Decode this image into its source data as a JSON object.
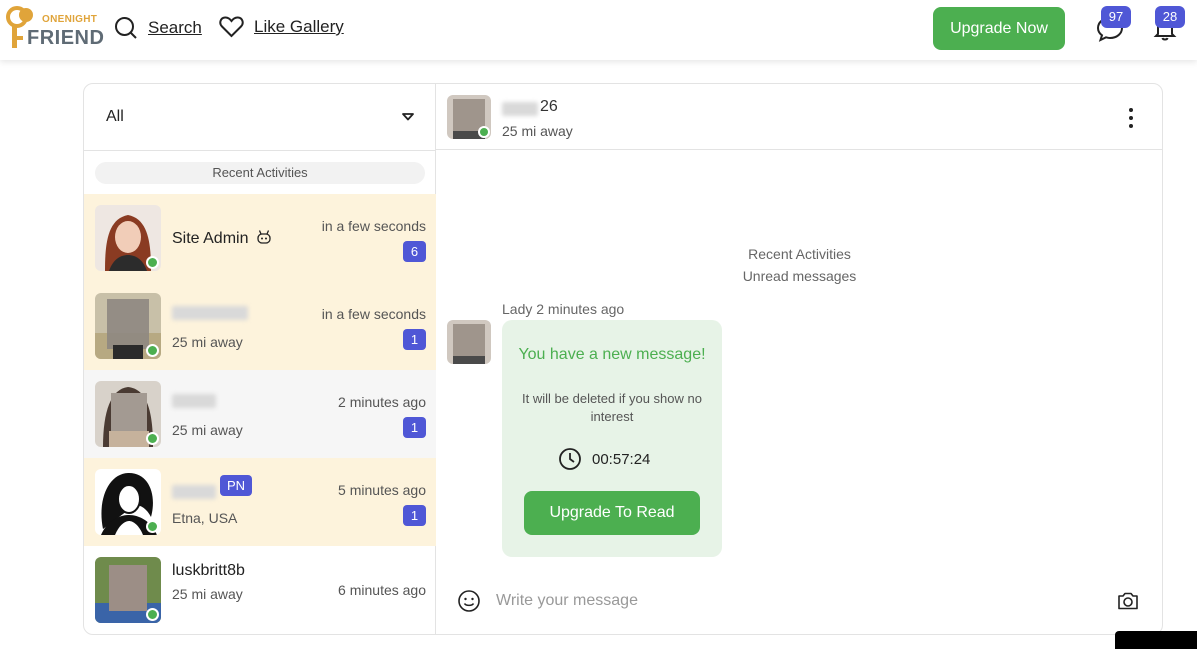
{
  "header": {
    "logo_top": "ONENIGHT",
    "logo_bottom": "FRIEND",
    "search_label": "Search",
    "like_gallery_label": "Like Gallery",
    "upgrade_label": "Upgrade Now",
    "messages_count": "97",
    "notifications_count": "28",
    "accent_color": "#4caf50",
    "badge_color": "#4f57d6"
  },
  "sidebar": {
    "filter_value": "All",
    "recent_label": "Recent Activities",
    "conversations": [
      {
        "name": "Site Admin",
        "subtitle": "",
        "time": "in a few seconds",
        "unread": "6",
        "online": true
      },
      {
        "name": "",
        "subtitle": "25 mi away",
        "time": "in a few seconds",
        "unread": "1",
        "online": true
      },
      {
        "name": "",
        "subtitle": "25 mi away",
        "time": "2 minutes ago",
        "unread": "1",
        "online": true
      },
      {
        "name": "",
        "badge": "PN",
        "subtitle": "Etna, USA",
        "time": "5 minutes ago",
        "unread": "1",
        "online": true
      },
      {
        "name": "luskbritt8b",
        "subtitle": "25 mi away",
        "time": "6 minutes ago",
        "unread": "",
        "online": true
      }
    ]
  },
  "chat": {
    "header_age": "26",
    "header_distance": "25 mi away",
    "divider_1": "Recent Activities",
    "divider_2": "Unread messages",
    "message_meta": "Lady 2 minutes ago",
    "locked_title": "You have a new message!",
    "locked_text": "It will be deleted if you show no interest",
    "timer": "00:57:24",
    "upgrade_read_label": "Upgrade To Read",
    "composer_placeholder": "Write your message"
  }
}
